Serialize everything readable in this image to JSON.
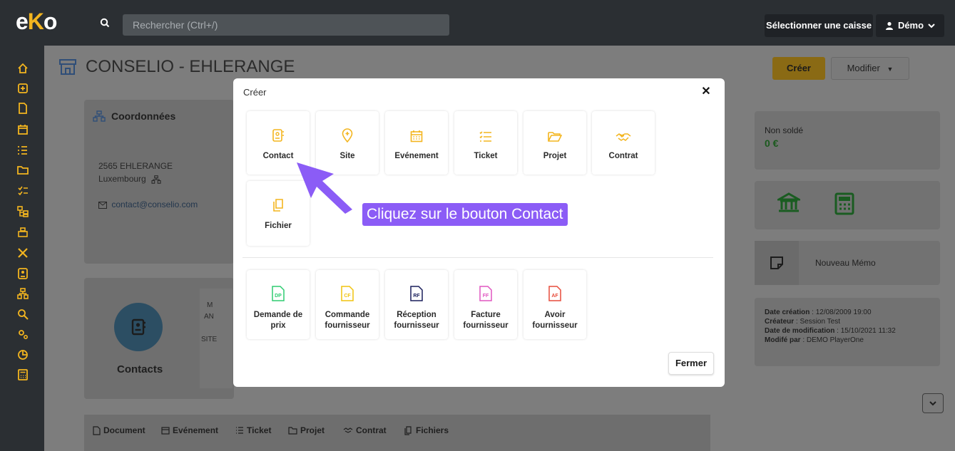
{
  "app": {
    "logo": "eKo"
  },
  "header": {
    "search_placeholder": "Rechercher (Ctrl+/)",
    "caisse_label": "Sélectionner une caisse",
    "user_label": "Démo"
  },
  "page": {
    "title": "CONSELIO - EHLERANGE"
  },
  "coordonnees": {
    "heading": "Coordonnées",
    "address_line1": "2565 EHLERANGE",
    "address_line2": "Luxembourg",
    "email": "contact@conselio.com"
  },
  "contacts": {
    "label": "Contacts",
    "sub_fragment1": "M",
    "sub_fragment2": "AN",
    "sub_fragment3": "SITE"
  },
  "tabs": [
    {
      "label": "Document"
    },
    {
      "label": "Evénement"
    },
    {
      "label": "Ticket"
    },
    {
      "label": "Projet"
    },
    {
      "label": "Contrat"
    },
    {
      "label": "Fichiers"
    }
  ],
  "right": {
    "creer_label": "Créer",
    "modifier_label": "Modifier",
    "non_solde_label": "Non soldé",
    "non_solde_value": "0 €",
    "memo_label": "Nouveau Mémo",
    "meta": {
      "date_creation_label": "Date création",
      "date_creation_value": " : 12/08/2009 19:00",
      "createur_label": "Créateur",
      "createur_value": " : Session Test",
      "date_modif_label": "Date de modification",
      "date_modif_value": " : 15/10/2021 11:32",
      "modifie_par_label": "Modifé par",
      "modifie_par_value": " : DEMO PlayerOne"
    }
  },
  "modal": {
    "title": "Créer",
    "close_glyph": "✕",
    "top_tiles": [
      {
        "label": "Contact",
        "icon": "contact-icon"
      },
      {
        "label": "Site",
        "icon": "location-pin-icon"
      },
      {
        "label": "Evénement",
        "icon": "calendar-icon"
      },
      {
        "label": "Ticket",
        "icon": "checklist-icon"
      },
      {
        "label": "Projet",
        "icon": "folder-icon"
      },
      {
        "label": "Contrat",
        "icon": "handshake-icon"
      },
      {
        "label": "Fichier",
        "icon": "file-icon"
      }
    ],
    "bottom_tiles": [
      {
        "label": "Demande de prix",
        "abbr": "DP",
        "color": "#2ecc71"
      },
      {
        "label": "Commande fournisseur",
        "abbr": "CF",
        "color": "#f1c40f"
      },
      {
        "label": "Réception fournisseur",
        "abbr": "RF",
        "color": "#1a1f5c"
      },
      {
        "label": "Facture fournisseur",
        "abbr": "FF",
        "color": "#e056c1"
      },
      {
        "label": "Avoir fournisseur",
        "abbr": "AF",
        "color": "#e74c3c"
      }
    ],
    "fermer_label": "Fermer"
  },
  "annotation": {
    "text": "Cliquez sur le bouton Contact"
  },
  "colors": {
    "accent": "#f3b51f",
    "topbar": "#2b2f33",
    "callout": "#8b5cf6"
  }
}
